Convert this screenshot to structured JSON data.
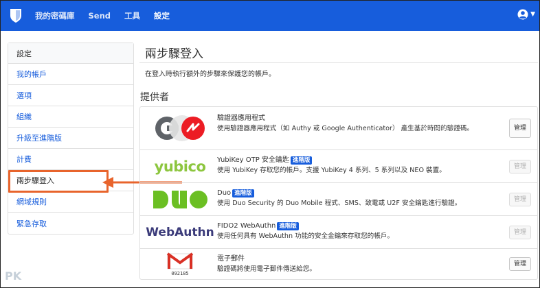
{
  "nav": {
    "items": [
      {
        "label": "我的密碼庫"
      },
      {
        "label": "Send"
      },
      {
        "label": "工具"
      },
      {
        "label": "設定"
      }
    ]
  },
  "sidebar": {
    "header": "設定",
    "items": [
      {
        "label": "我的帳戶"
      },
      {
        "label": "選項"
      },
      {
        "label": "組織"
      },
      {
        "label": "升級至進階版"
      },
      {
        "label": "計費"
      },
      {
        "label": "兩步驟登入"
      },
      {
        "label": "網域規則"
      },
      {
        "label": "緊急存取"
      }
    ]
  },
  "main": {
    "title": "兩步驟登入",
    "description": "在登入時執行額外的步驟來保護您的帳戶。",
    "providers_title": "提供者",
    "providers": [
      {
        "name": "驗證器應用程式",
        "badge": "",
        "desc": "使用驗證器應用程式（如 Authy 或 Google Authenticator） 產生基於時間的驗證碼。",
        "manage": "管理"
      },
      {
        "name": "YubiKey OTP 安全鑰匙",
        "badge": "進階版",
        "desc": "使用 YubiKey 存取您的帳戶。支援 YubiKey 4 系列、5 系列以及 NEO 裝置。",
        "manage": "管理",
        "logo_text": "yubico"
      },
      {
        "name": "Duo",
        "badge": "進階版",
        "desc": "使用 Duo Security 的 Duo Mobile 程式、SMS、致電或 U2F 安全鑰匙進行驗證。",
        "manage": "管理"
      },
      {
        "name": "FIDO2 WebAuthn",
        "badge": "進階版",
        "desc": "使用任何具有 WebAuthn 功能的安全金鑰來存取您的帳戶。",
        "manage": "管理",
        "logo_text": "WebAuthn"
      },
      {
        "name": "電子郵件",
        "badge": "",
        "desc": "驗證碼將使用電子郵件傳送給您。",
        "manage": "管理",
        "logo_text": "092185"
      }
    ]
  },
  "watermark": "PK",
  "colors": {
    "brand": "#175ddc",
    "highlight": "#e8642c"
  },
  "icons": {
    "brand": "shield-icon",
    "user": "user-circle-icon",
    "caret": "caret-down-icon"
  }
}
